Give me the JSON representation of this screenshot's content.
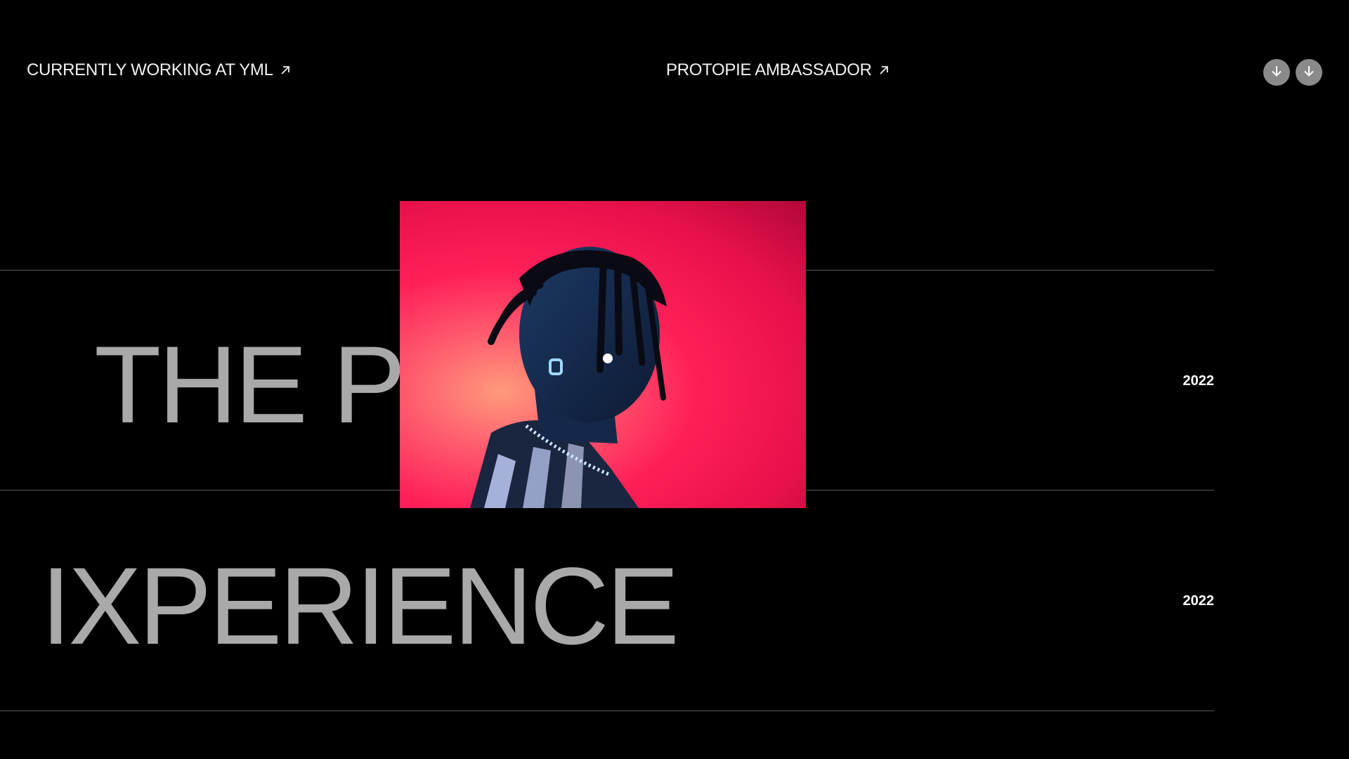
{
  "header": {
    "left_link_label": "CURRENTLY WORKING AT YML",
    "center_link_label": "PROTOPIE AMBASSADOR",
    "link_icon": "arrow-up-right-icon",
    "nav_buttons": [
      {
        "icon": "arrow-down-icon"
      },
      {
        "icon": "arrow-down-icon"
      }
    ]
  },
  "projects": [
    {
      "title": "THE PL",
      "year": "2022"
    },
    {
      "title": "IXPERIENCE",
      "year": "2022"
    }
  ],
  "preview": {
    "subject": "portrait-photo"
  },
  "colors": {
    "background": "#000000",
    "title_text": "#a9a9a9",
    "divider": "#5a5a5a",
    "nav_button": "#8a8a8a",
    "photo_backdrop": "#ff1f58"
  }
}
